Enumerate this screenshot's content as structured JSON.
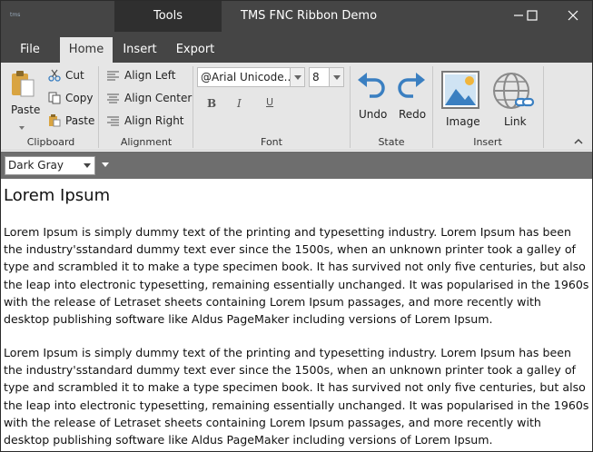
{
  "window": {
    "title": "TMS FNC Ribbon Demo",
    "app_icon_text": "tms",
    "context_tab": "Tools"
  },
  "tabs": [
    {
      "label": "File",
      "active": false
    },
    {
      "label": "Home",
      "active": true
    },
    {
      "label": "Insert",
      "active": false
    },
    {
      "label": "Export",
      "active": false
    }
  ],
  "ribbon": {
    "clipboard": {
      "label": "Clipboard",
      "paste_label": "Paste",
      "cut_label": "Cut",
      "copy_label": "Copy",
      "paste_small_label": "Paste"
    },
    "alignment": {
      "label": "Alignment",
      "left": "Align Left",
      "center": "Align Center",
      "right": "Align Right"
    },
    "font": {
      "label": "Font",
      "family": "@Arial Unicode...",
      "size": "8",
      "bold": "B",
      "italic": "I",
      "underline": "U"
    },
    "state": {
      "label": "State",
      "undo": "Undo",
      "redo": "Redo"
    },
    "insert": {
      "label": "Insert",
      "image": "Image",
      "link": "Link"
    }
  },
  "style_selector": {
    "value": "Dark Gray"
  },
  "document": {
    "heading": "Lorem Ipsum",
    "paragraphs": [
      "Lorem Ipsum is simply dummy text of the printing and typesetting industry. Lorem Ipsum has been the industry'sstandard dummy text ever since the 1500s, when an unknown printer took a galley of type and scrambled it to make a type specimen book. It has survived not only five centuries, but also the leap into electronic typesetting, remaining essentially unchanged. It was popularised in the 1960s with the release of Letraset sheets containing Lorem Ipsum passages, and more recently with desktop publishing software like Aldus PageMaker including versions of Lorem Ipsum.",
      "Lorem Ipsum is simply dummy text of the printing and typesetting industry. Lorem Ipsum has been the industry'sstandard dummy text ever since the 1500s, when an unknown printer took a galley of type and scrambled it to make a type specimen book. It has survived not only five centuries, but also the leap into electronic typesetting, remaining essentially unchanged. It was popularised in the 1960s with the release of Letraset sheets containing Lorem Ipsum passages, and more recently with desktop publishing software like Aldus PageMaker including versions of Lorem Ipsum."
    ]
  },
  "colors": {
    "titlebar": "#454545",
    "ribbon_bg": "#e6e6e6",
    "accent_blue": "#3a7fc1",
    "stylebar": "#6e6e6e"
  }
}
